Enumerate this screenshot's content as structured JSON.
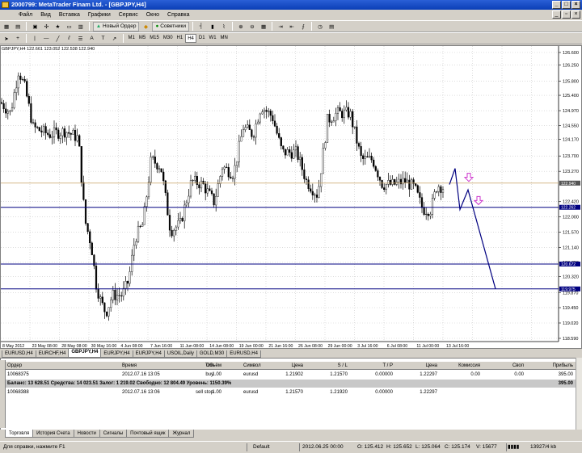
{
  "window": {
    "title": "2000799: MetaTrader Finam Ltd. - [GBPJPY,H4]"
  },
  "menu": [
    "Файл",
    "Вид",
    "Вставка",
    "Графики",
    "Сервис",
    "Окно",
    "Справка"
  ],
  "toolbar": {
    "new_order": "Новый Ордер",
    "advisors": "Советники",
    "timeframes": [
      "M1",
      "M5",
      "M15",
      "M30",
      "H1",
      "H4",
      "D1",
      "W1",
      "MN"
    ],
    "active_tf": "H4"
  },
  "chart": {
    "symbol_label": "GBPJPY,H4  122.661 123.052 122.538 122.940",
    "price_labels": [
      "126.600",
      "126.250",
      "125.800",
      "125.400",
      "124.970",
      "124.550",
      "124.170",
      "123.700",
      "123.270",
      "122.420",
      "122.000",
      "121.570",
      "121.140",
      "120.720",
      "120.320",
      "119.870",
      "119.450",
      "119.020",
      "118.590"
    ],
    "time_labels": [
      "8 May 2012",
      "23 May 08:00",
      "28 May 08:00",
      "30 May 16:00",
      "4 Jun 08:00",
      "7 Jun 16:00",
      "11 Jun 08:00",
      "14 Jun 08:00",
      "19 Jun 00:00",
      "21 Jun 16:00",
      "26 Jun 08:00",
      "29 Jun 00:00",
      "3 Jul 16:00",
      "6 Jul 08:00",
      "11 Jul 00:00",
      "13 Jul 16:00"
    ],
    "hlines_labels": [
      "122.940",
      "122.262",
      "120.672",
      "119.975"
    ]
  },
  "chart_tabs": [
    "EURUSD,H4",
    "EURCHF,H4",
    "GBPJPY,H4",
    "EURJPY,H4",
    "EURJPY,H4",
    "USOIL,Daily",
    "GOLD,M30",
    "EURUSD,H4"
  ],
  "chart_tabs_active": 2,
  "terminal": {
    "headers": [
      "Ордер",
      "/",
      "Время",
      "Тип",
      "Объём",
      "Символ",
      "Цена",
      "S / L",
      "T / P",
      "Цена",
      "Комиссия",
      "Своп",
      "Прибыль"
    ],
    "rows": [
      {
        "order": "10068375",
        "time": "2012.07.16 13:05",
        "type": "buy",
        "volume": "1.00",
        "symbol": "eurusd",
        "price": "1.21902",
        "sl": "1.21570",
        "tp": "0.00000",
        "cur": "1.22297",
        "commission": "0.00",
        "swap": "0.00",
        "profit": "395.00"
      }
    ],
    "balance": {
      "text": "Баланс: 13 628.51  Средства: 14 023.51  Залог: 1 219.02  Свободно: 12 804.49  Уровень: 1150.39%",
      "profit": "395.00"
    },
    "pending": [
      {
        "order": "10068388",
        "time": "2012.07.16 13:06",
        "type": "sell stop",
        "volume": "1.00",
        "symbol": "eurusd",
        "price": "1.21570",
        "sl": "1.21920",
        "tp": "0.00000",
        "cur": "1.22297"
      }
    ]
  },
  "terminal_tabs": [
    "Торговля",
    "История Счета",
    "Новости",
    "Сигналы",
    "Почтовый ящик",
    "Журнал"
  ],
  "status": {
    "help": "Для справки, нажмите F1",
    "profile": "Default",
    "datetime": "2012.06.25 00:00",
    "open": "O: 125.412",
    "high": "H: 125.652",
    "low": "L: 125.064",
    "close": "C: 125.174",
    "volume": "V: 15677",
    "traffic": "13927/4 kb"
  },
  "colors": {
    "level_line": "#000080",
    "arrow": "#cc33cc",
    "candles": "#000000"
  }
}
